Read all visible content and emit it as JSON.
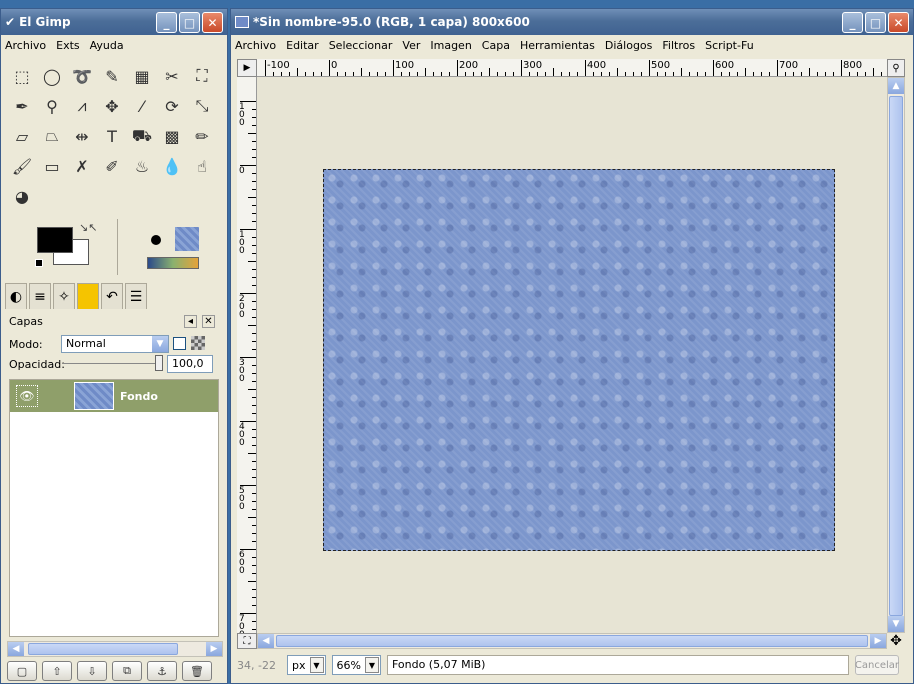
{
  "toolbox": {
    "title": "El Gimp",
    "menu": [
      "Archivo",
      "Exts",
      "Ayuda"
    ],
    "tools": [
      {
        "name": "rect-select-icon",
        "glyph": "⬚"
      },
      {
        "name": "ellipse-select-icon",
        "glyph": "◯"
      },
      {
        "name": "lasso-icon",
        "glyph": "➰"
      },
      {
        "name": "magic-wand-icon",
        "glyph": "✎"
      },
      {
        "name": "color-select-icon",
        "glyph": "▦"
      },
      {
        "name": "scissors-select-icon",
        "glyph": "✂"
      },
      {
        "name": "foreground-select-icon",
        "glyph": "⛶"
      },
      {
        "name": "paths-icon",
        "glyph": "✒"
      },
      {
        "name": "color-picker-icon",
        "glyph": "⚲"
      },
      {
        "name": "measure-icon",
        "glyph": "⩘"
      },
      {
        "name": "move-icon",
        "glyph": "✥"
      },
      {
        "name": "crop-icon",
        "glyph": "⁄"
      },
      {
        "name": "rotate-icon",
        "glyph": "⟳"
      },
      {
        "name": "scale-icon",
        "glyph": "⤡"
      },
      {
        "name": "shear-icon",
        "glyph": "▱"
      },
      {
        "name": "perspective-icon",
        "glyph": "⏢"
      },
      {
        "name": "flip-icon",
        "glyph": "⇹"
      },
      {
        "name": "text-icon",
        "glyph": "T"
      },
      {
        "name": "bucket-fill-icon",
        "glyph": "⛟"
      },
      {
        "name": "blend-icon",
        "glyph": "▩"
      },
      {
        "name": "pencil-icon",
        "glyph": "✏"
      },
      {
        "name": "paintbrush-icon",
        "glyph": "🖌"
      },
      {
        "name": "eraser-icon",
        "glyph": "▭"
      },
      {
        "name": "airbrush-icon",
        "glyph": "✗"
      },
      {
        "name": "ink-icon",
        "glyph": "✐"
      },
      {
        "name": "clone-icon",
        "glyph": "♨"
      },
      {
        "name": "blur-icon",
        "glyph": "💧"
      },
      {
        "name": "smudge-icon",
        "glyph": "☝"
      },
      {
        "name": "dodge-burn-icon",
        "glyph": "◕"
      }
    ],
    "dock_tabs": [
      {
        "name": "tool-options-tab-icon",
        "glyph": "◐"
      },
      {
        "name": "devices-tab-icon",
        "glyph": "≡"
      },
      {
        "name": "undo-history-tab-icon",
        "glyph": "✧"
      },
      {
        "name": "patterns-tab-icon",
        "glyph": " "
      },
      {
        "name": "undo-tab-icon",
        "glyph": "↶"
      },
      {
        "name": "layers-tab-icon",
        "glyph": "☰"
      }
    ],
    "layers": {
      "heading": "Capas",
      "mode_label": "Modo:",
      "mode_value": "Normal",
      "opacity_label": "Opacidad:",
      "opacity_value": "100,0",
      "items": [
        {
          "name": "Fondo",
          "visible": true
        }
      ]
    },
    "bottom_buttons": [
      {
        "name": "new-layer-icon",
        "glyph": "▢"
      },
      {
        "name": "raise-layer-icon",
        "glyph": "⇧"
      },
      {
        "name": "lower-layer-icon",
        "glyph": "⇩"
      },
      {
        "name": "duplicate-layer-icon",
        "glyph": "⧉"
      },
      {
        "name": "anchor-layer-icon",
        "glyph": "⚓"
      },
      {
        "name": "delete-layer-icon",
        "glyph": "🗑"
      }
    ]
  },
  "image_window": {
    "title": "*Sin nombre-95.0 (RGB, 1 capa) 800x600",
    "menu": [
      "Archivo",
      "Editar",
      "Seleccionar",
      "Ver",
      "Imagen",
      "Capa",
      "Herramientas",
      "Diálogos",
      "Filtros",
      "Script-Fu"
    ],
    "ruler_h_labels": [
      "-100",
      "0",
      "100",
      "200",
      "300",
      "400",
      "500",
      "600",
      "700",
      "800"
    ],
    "ruler_v_labels": [
      "100",
      "0",
      "100",
      "200",
      "300",
      "400",
      "500",
      "600",
      "700"
    ],
    "status": {
      "coords": "34, -22",
      "unit": "px",
      "zoom": "66%",
      "message": "Fondo (5,07 MiB)",
      "cancel": "Cancelar"
    }
  }
}
